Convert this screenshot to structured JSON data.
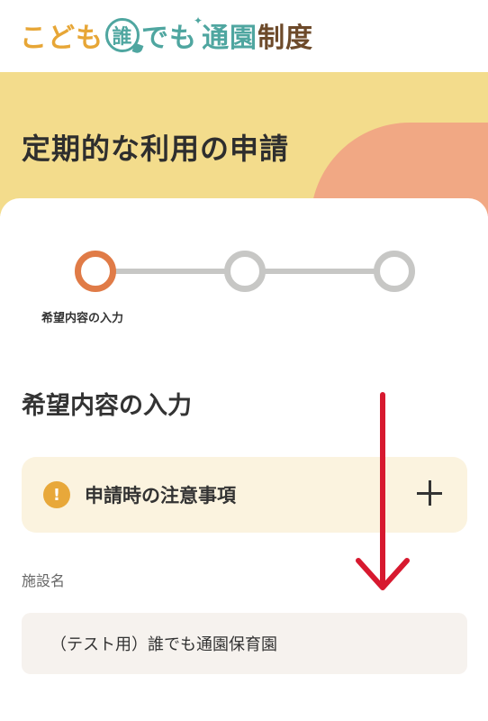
{
  "header": {
    "logo_part1": "こども",
    "logo_circle": "誰",
    "logo_part2": "でも",
    "logo_part3": "通園",
    "logo_part4": "制度"
  },
  "hero": {
    "title": "定期的な利用の申請"
  },
  "stepper": {
    "active_step_label": "希望内容の入力"
  },
  "main": {
    "section_title": "希望内容の入力",
    "notice": {
      "icon": "exclamation-icon",
      "text": "申請時の注意事項",
      "toggle_icon": "plus-icon"
    },
    "facility": {
      "label": "施設名",
      "value": "（テスト用）誰でも通園保育園"
    }
  },
  "colors": {
    "hero_bg": "#f3dc8c",
    "hero_blob": "#f1a884",
    "step_active": "#e07b47",
    "step_inactive": "#c7c7c5",
    "notice_bg": "#fbf3df",
    "notice_icon": "#e8a83a",
    "annotation_arrow": "#d7192f",
    "brand_teal": "#4fa6a0"
  }
}
